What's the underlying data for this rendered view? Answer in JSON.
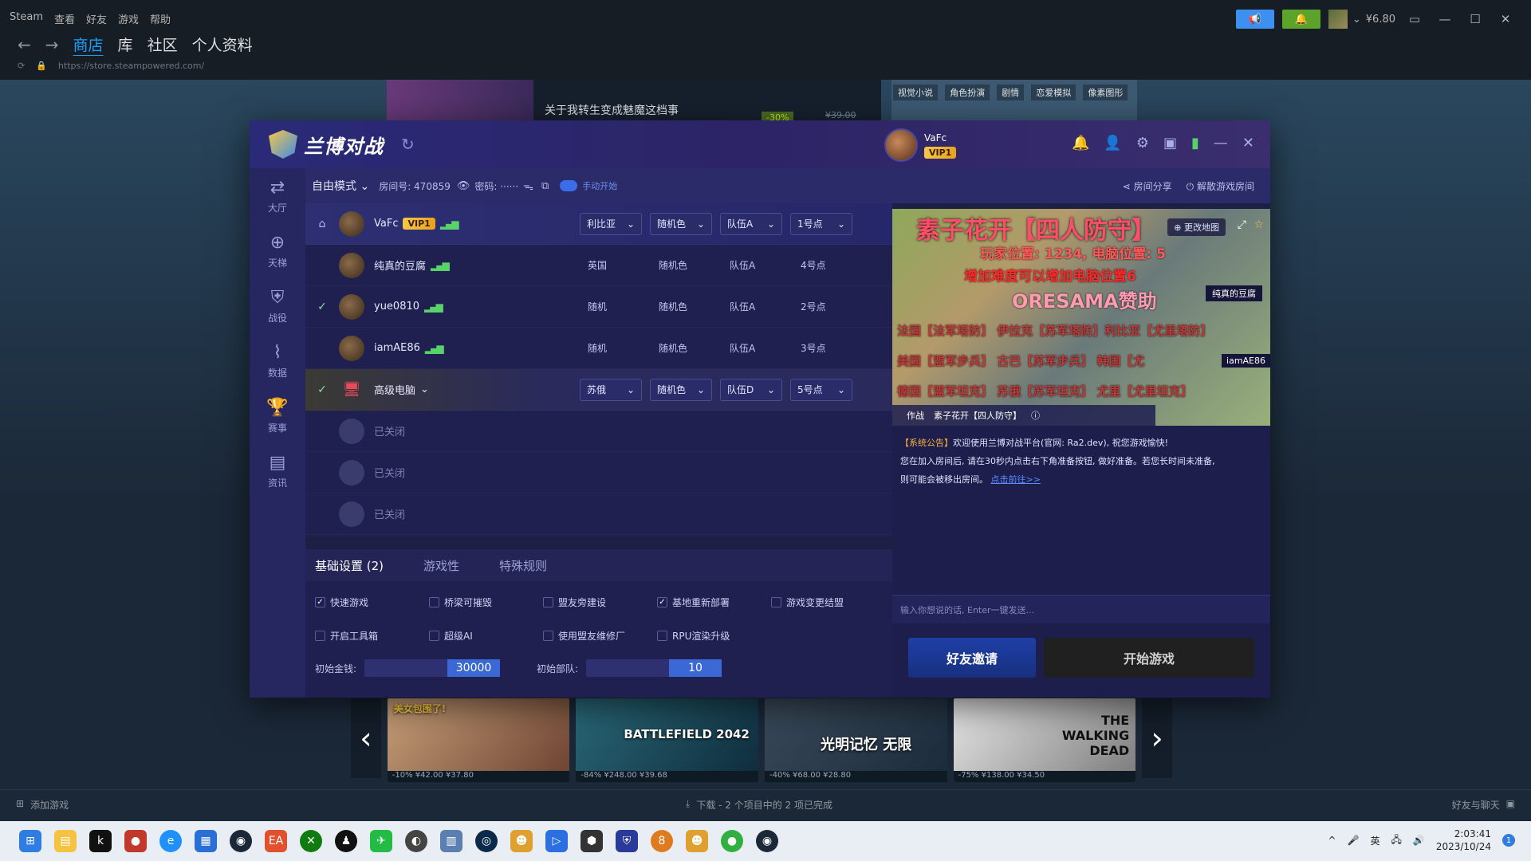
{
  "steam": {
    "brand": "Steam",
    "menu": [
      "查看",
      "好友",
      "游戏",
      "帮助"
    ],
    "nav": [
      "商店",
      "库",
      "社区",
      "个人资料"
    ],
    "url": "https://store.steampowered.com/",
    "wallet": "¥6.80",
    "add_game": "添加游戏",
    "download_status": "下载 - 2 个项目中的 2 项已完成",
    "friends_chat": "好友与聊天",
    "store_item_title": "关于我转生变成魅魔这档事",
    "store_item_discount": "-30%",
    "store_item_price": "¥39.00",
    "tags": [
      "视觉小说",
      "角色扮演",
      "剧情",
      "恋爱模拟",
      "像素图形"
    ],
    "carousel": [
      {
        "title": "美女包围了!",
        "price": "-10%  ¥42.00  ¥37.80"
      },
      {
        "title": "BATTLEFIELD 2042",
        "price": "-84%  ¥248.00  ¥39.68"
      },
      {
        "title": "光明记忆 无限",
        "price": "-40%  ¥68.00  ¥28.80"
      },
      {
        "title": "THE WALKING DEAD",
        "price": "-75%  ¥138.00  ¥34.50"
      }
    ]
  },
  "lanbo": {
    "app_name": "兰博对战",
    "user": {
      "name": "VaFc",
      "vip": "VIP1"
    },
    "sidebar": [
      {
        "icon": "lobby-icon",
        "label": "大厅"
      },
      {
        "icon": "ladder-icon",
        "label": "天梯"
      },
      {
        "icon": "campaign-icon",
        "label": "战役"
      },
      {
        "icon": "data-icon",
        "label": "数据"
      },
      {
        "icon": "trophy-icon",
        "label": "赛事"
      },
      {
        "icon": "news-icon",
        "label": "资讯"
      }
    ],
    "room": {
      "mode": "自由模式",
      "room_no": "房间号: 470859",
      "password": "密码: ······",
      "manual_start": "手动开始",
      "share": "房间分享",
      "dismiss": "解散游戏房间"
    },
    "players": [
      {
        "name": "VaFc",
        "vip": "VIP1",
        "country": "利比亚",
        "color": "随机色",
        "team": "队伍A",
        "spot": "1号点",
        "editable": true
      },
      {
        "name": "纯真的豆腐",
        "country": "英国",
        "color": "随机色",
        "team": "队伍A",
        "spot": "4号点"
      },
      {
        "name": "yue0810",
        "country": "随机",
        "color": "随机色",
        "team": "队伍A",
        "spot": "2号点"
      },
      {
        "name": "iamAE86",
        "country": "随机",
        "color": "随机色",
        "team": "队伍A",
        "spot": "3号点"
      },
      {
        "name": "高级电脑",
        "country": "苏俄",
        "color": "随机色",
        "team": "队伍D",
        "spot": "5号点",
        "editable": true
      }
    ],
    "closed_label": "已关闭",
    "tabs": [
      "基础设置 (2)",
      "游戏性",
      "特殊规则"
    ],
    "options_row1": [
      {
        "label": "快速游戏",
        "checked": true
      },
      {
        "label": "桥梁可摧毁",
        "checked": false
      },
      {
        "label": "盟友旁建设",
        "checked": false
      },
      {
        "label": "基地重新部署",
        "checked": true
      },
      {
        "label": "游戏变更结盟",
        "checked": false
      }
    ],
    "options_row2": [
      {
        "label": "开启工具箱",
        "checked": false
      },
      {
        "label": "超级AI",
        "checked": false
      },
      {
        "label": "使用盟友维修厂",
        "checked": false
      },
      {
        "label": "RPU渲染升级",
        "checked": false
      }
    ],
    "initial_money_label": "初始金钱:",
    "initial_money": "30000",
    "initial_units_label": "初始部队:",
    "initial_units": "10",
    "map": {
      "title": "素子花开【四人防守】",
      "change_map": "更改地图",
      "line1": "玩家位置: 1234, 电脑位置: 5",
      "line2": "增加难度可以增加电脑位置6",
      "line3": "ORESAMA赞助",
      "line4": "法国【法军塔防】 伊拉克【苏军塔防】利比亚【尤里塔防】",
      "line5": "美国【盟军步兵】 古巴【苏军步兵】 韩国【尤",
      "line6": "德国【盟军坦克】 苏俄【苏军坦克】 尤里【尤里坦克】",
      "tag_player": "纯真的豆腐",
      "tag_player2": "iamAE86",
      "type": "作战",
      "name_bar": "素子花开【四人防守】"
    },
    "notice_tag": "【系统公告】",
    "notice_1": "欢迎使用兰博对战平台(官网: Ra2.dev), 祝您游戏愉快!",
    "notice_2": "您在加入房间后, 请在30秒内点击右下角准备按钮, 做好准备。若您长时间未准备,",
    "notice_3": "则可能会被移出房间。",
    "notice_link": "点击前往>>",
    "chat_placeholder": "输入你想说的话, Enter一键发送...",
    "invite_btn": "好友邀请",
    "start_btn": "开始游戏"
  },
  "taskbar": {
    "time": "2:03:41",
    "date": "2023/10/24",
    "ime": "英",
    "notif_count": "1"
  },
  "colors": {
    "steam_accent": "#1a9fff",
    "lanbo_bg": "#1e1f45",
    "vip_gold": "#f7c847",
    "signal_green": "#58d36a"
  }
}
